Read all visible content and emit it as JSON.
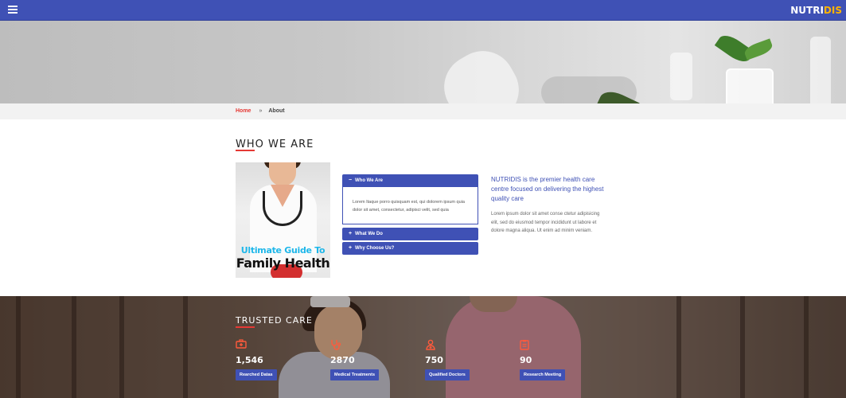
{
  "brand": {
    "part1": "NUTRI",
    "part2": "DIS"
  },
  "breadcrumb": {
    "home": "Home",
    "separator": "»",
    "current": "About"
  },
  "who": {
    "title": "WHO WE ARE",
    "book": {
      "line1": "Ultimate Guide To",
      "line2": "Family Health"
    },
    "accordion": [
      {
        "label": "Who We Are",
        "marker": "−",
        "open": true,
        "body": "Lorem Itaque porro quisquam est, qui dolorem ipsum quia dolor sit amet, consectetur, adipisci velit, sed quia"
      },
      {
        "label": "What We Do",
        "marker": "+",
        "open": false
      },
      {
        "label": "Why Choose Us?",
        "marker": "+",
        "open": false
      }
    ],
    "lead": "NUTRIDIS is the premier health care centre focused on delivering the highest quality care",
    "paragraph": "Lorem ipsum dolor sit amet conse ctetur adipisicing elit, sed do eiusmod tempor incididunt ut labore et dolore magna aliqua. Ut enim ad minim veniam."
  },
  "trusted": {
    "title": "TRUSTED CARE",
    "stats": [
      {
        "icon": "medical-kit-icon",
        "value": "1,546",
        "label": "Rearched Datas"
      },
      {
        "icon": "stethoscope-icon",
        "value": "2870",
        "label": "Medical Treatments"
      },
      {
        "icon": "doctor-icon",
        "value": "750",
        "label": "Qualified Doctors"
      },
      {
        "icon": "clipboard-icon",
        "value": "90",
        "label": "Research Meeting"
      }
    ]
  },
  "colors": {
    "primary": "#3f51b5",
    "accent": "#e53935",
    "brand_highlight": "#ffb300",
    "icon": "#ff5a3c"
  }
}
